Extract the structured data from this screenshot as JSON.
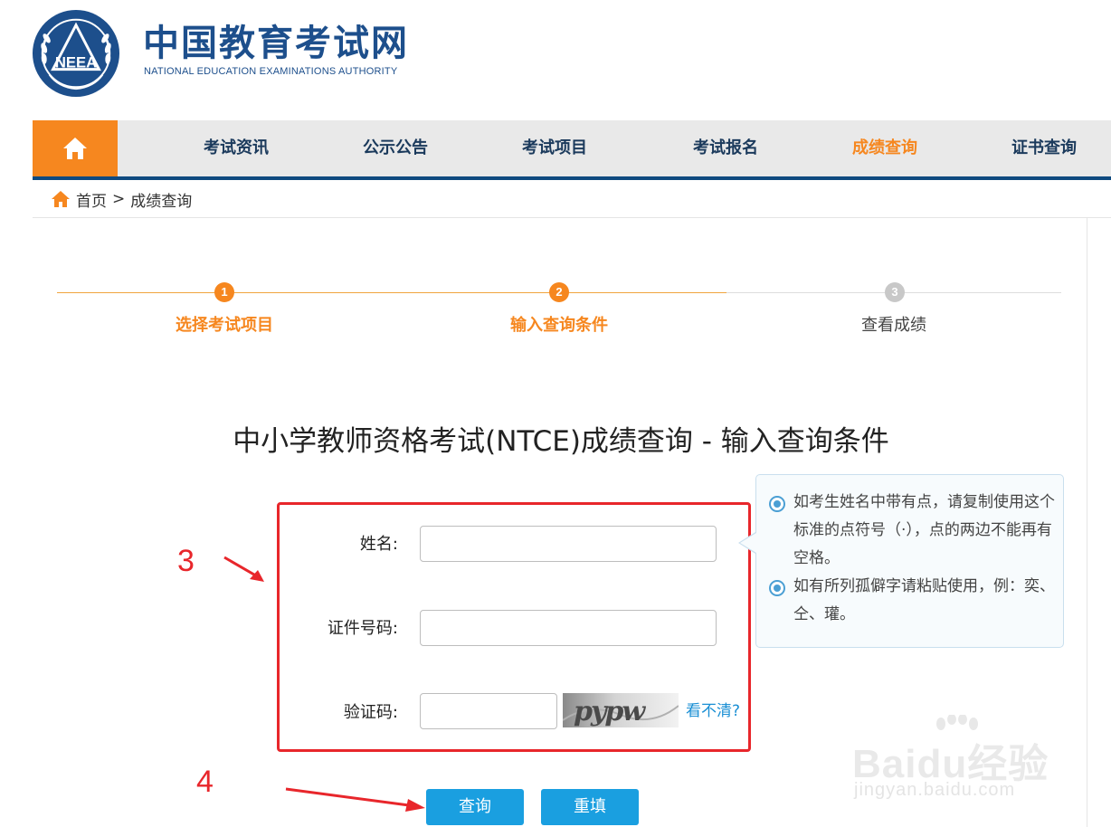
{
  "header": {
    "site_title": "中国教育考试网",
    "site_subtitle": "NATIONAL EDUCATION EXAMINATIONS AUTHORITY",
    "emblem_text": "NEEA"
  },
  "nav": {
    "items": [
      {
        "label": "考试资讯"
      },
      {
        "label": "公示公告"
      },
      {
        "label": "考试项目"
      },
      {
        "label": "考试报名"
      },
      {
        "label": "成绩查询",
        "active": true
      },
      {
        "label": "证书查询"
      }
    ]
  },
  "breadcrumb": {
    "home": "首页",
    "separator": ">",
    "current": "成绩查询"
  },
  "steps": [
    {
      "number": "1",
      "label": "选择考试项目",
      "status": "done"
    },
    {
      "number": "2",
      "label": "输入查询条件",
      "status": "done"
    },
    {
      "number": "3",
      "label": "查看成绩",
      "status": "todo"
    }
  ],
  "page_title": "中小学教师资格考试(NTCE)成绩查询 - 输入查询条件",
  "form": {
    "name_label": "姓名:",
    "name_value": "",
    "id_label": "证件号码:",
    "id_value": "",
    "captcha_label": "验证码:",
    "captcha_value": "",
    "captcha_image_text": "pypw",
    "captcha_refresh": "看不清?"
  },
  "tips": [
    "如考生姓名中带有点，请复制使用这个标准的点符号（·），点的两边不能再有空格。",
    "如有所列孤僻字请粘贴使用，例：奕、仝、瓘。"
  ],
  "buttons": {
    "query": "查询",
    "reset": "重填"
  },
  "annotations": {
    "step3": "3",
    "step4": "4"
  },
  "watermark": {
    "brand": "Baidu经验",
    "domain": "jingyan.baidu.com"
  },
  "colors": {
    "primary_orange": "#f6871f",
    "nav_blue": "#0f4a80",
    "button_blue": "#1a9fe0",
    "annotation_red": "#e8262b"
  }
}
